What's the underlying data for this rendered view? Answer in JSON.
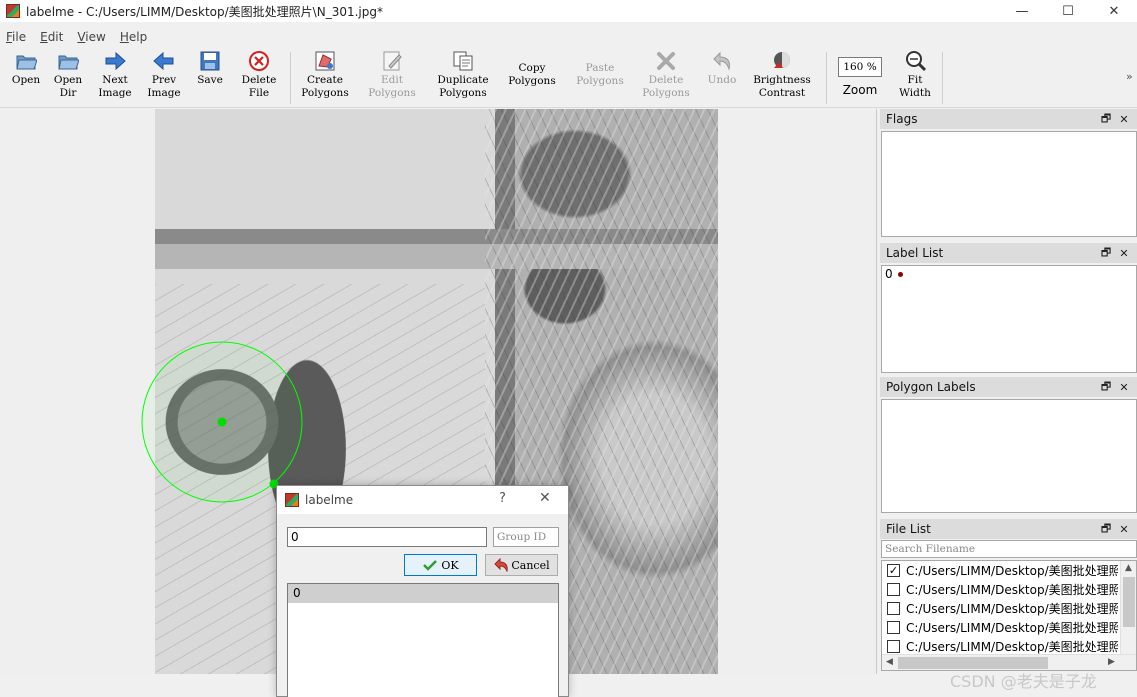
{
  "window": {
    "title": "labelme - C:/Users/LIMM/Desktop/美图批处理照片\\N_301.jpg*",
    "minimize": "—",
    "maximize": "☐",
    "close": "✕"
  },
  "menu": [
    {
      "key": "F",
      "rest": "ile"
    },
    {
      "key": "E",
      "rest": "dit"
    },
    {
      "key": "V",
      "rest": "iew"
    },
    {
      "key": "H",
      "rest": "elp"
    }
  ],
  "toolbar": {
    "open": "Open",
    "open_dir": "Open\nDir",
    "next_image": "Next\nImage",
    "prev_image": "Prev\nImage",
    "save": "Save",
    "delete_file": "Delete\nFile",
    "create_polygons": "Create\nPolygons",
    "edit_polygons": "Edit\nPolygons",
    "duplicate_polygons": "Duplicate\nPolygons",
    "copy_polygons": "Copy\nPolygons",
    "paste_polygons": "Paste\nPolygons",
    "delete_polygons": "Delete\nPolygons",
    "undo": "Undo",
    "brightness_contrast": "Brightness\nContrast",
    "zoom_value": "160 %",
    "zoom_label": "Zoom",
    "fit_width": "Fit\nWidth",
    "more": "»"
  },
  "docks": {
    "flags": {
      "title": "Flags"
    },
    "label_list": {
      "title": "Label List",
      "items": [
        {
          "label": "0",
          "color": "#8b0000"
        }
      ]
    },
    "polygon_labels": {
      "title": "Polygon Labels"
    },
    "file_list": {
      "title": "File List",
      "search_placeholder": "Search Filename",
      "files": [
        {
          "path": "C:/Users/LIMM/Desktop/美图批处理照片",
          "checked": true
        },
        {
          "path": "C:/Users/LIMM/Desktop/美图批处理照片",
          "checked": false
        },
        {
          "path": "C:/Users/LIMM/Desktop/美图批处理照片",
          "checked": false
        },
        {
          "path": "C:/Users/LIMM/Desktop/美图批处理照片",
          "checked": false
        },
        {
          "path": "C:/Users/LIMM/Desktop/美图批处理照片",
          "checked": false
        }
      ]
    },
    "float_icon": "🗗",
    "close_icon": "✕"
  },
  "dialog": {
    "title": "labelme",
    "help": "?",
    "close": "✕",
    "label_value": "0",
    "group_id_placeholder": "Group ID",
    "ok": "OK",
    "cancel": "Cancel",
    "labels": [
      "0"
    ]
  },
  "watermark": "CSDN @老夫是子龙",
  "colors": {
    "shape_outline": "#00ff00",
    "accent_border": "#0078d7"
  }
}
